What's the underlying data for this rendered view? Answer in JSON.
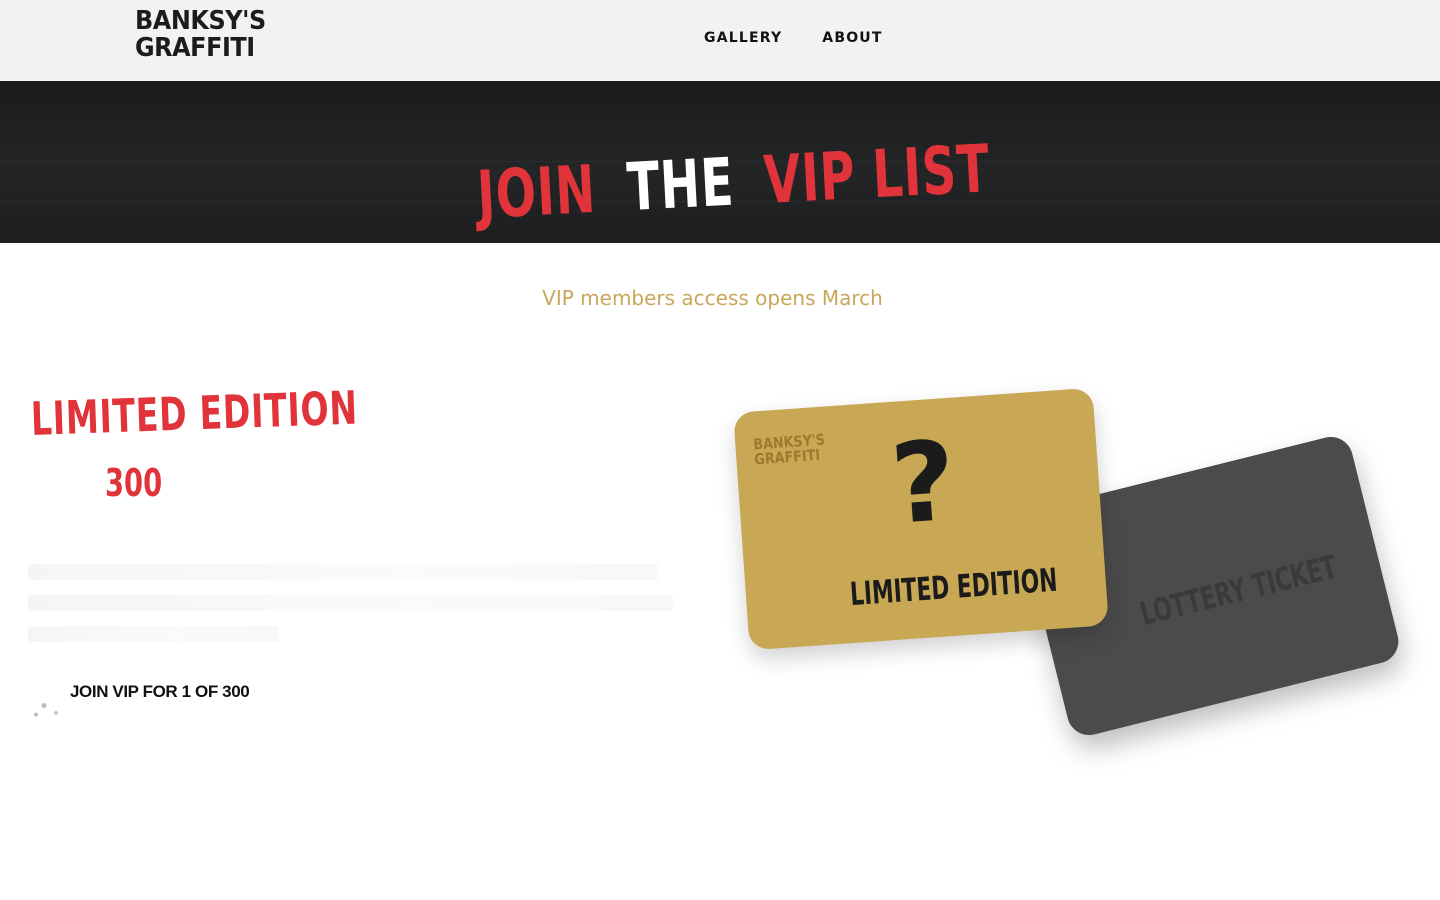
{
  "header": {
    "logo_line1": "BANKSY'S",
    "logo_line2": "GRAFFITI",
    "nav": [
      {
        "label": "GALLERY"
      },
      {
        "label": "ABOUT"
      }
    ]
  },
  "hero": {
    "title_part1": "JOIN",
    "title_part2": "THE",
    "title_part3": "VIP LIST"
  },
  "subtitle": "VIP members access opens March",
  "offer": {
    "title": "LIMITED EDITION",
    "count": "300",
    "cta_label": "JOIN VIP FOR 1 OF 300"
  },
  "cards": {
    "gold": {
      "logo_line1": "BANKSY'S",
      "logo_line2": "GRAFFITI",
      "symbol": "?",
      "label": "LIMITED EDITION"
    },
    "gray": {
      "label": "LOTTERY TICKET"
    }
  },
  "colors": {
    "accent_red": "#e0333a",
    "gold": "#c9a855",
    "gold_text": "#c9a75a",
    "card_gray": "#4b4b4b",
    "hero_dark": "#1f2021"
  }
}
